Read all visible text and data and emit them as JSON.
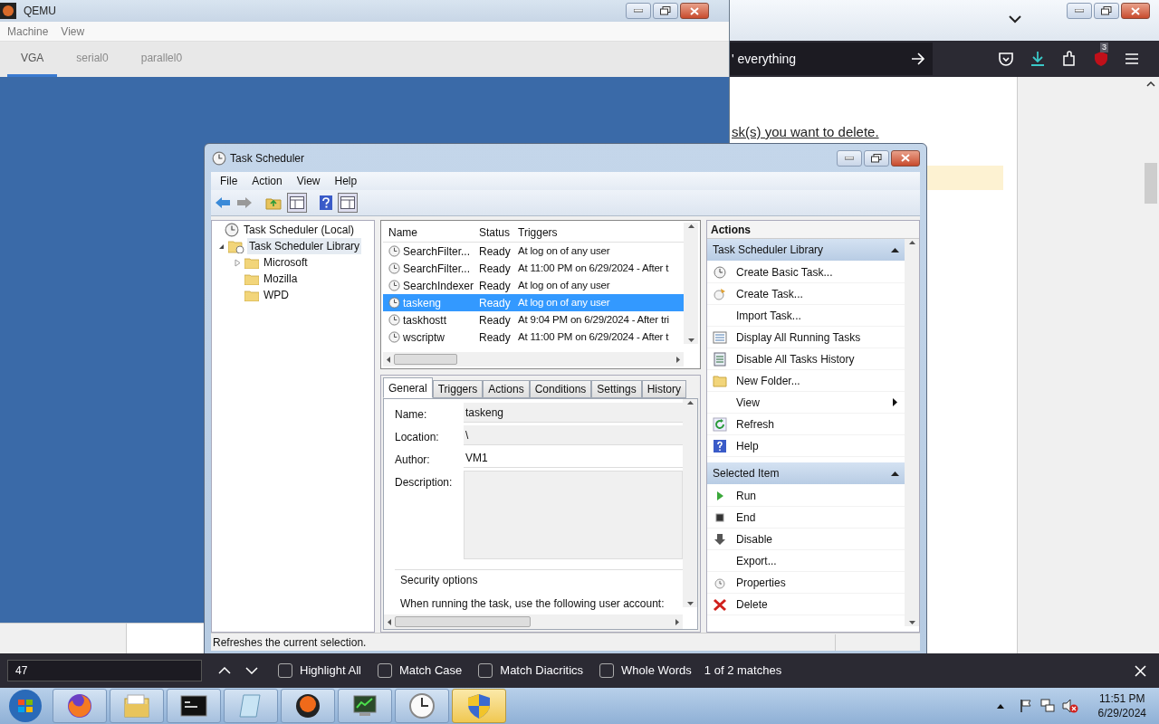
{
  "qemu": {
    "title": "QEMU",
    "menu": [
      "Machine",
      "View"
    ],
    "tabs": [
      {
        "label": "VGA",
        "selected": true
      },
      {
        "label": "serial0",
        "selected": false
      },
      {
        "label": "parallel0",
        "selected": false
      }
    ]
  },
  "browser": {
    "address_text": "' everything",
    "badge": "3",
    "page_text": "sk(s) you want to delete."
  },
  "task_scheduler": {
    "title": "Task Scheduler",
    "menu": [
      "File",
      "Action",
      "View",
      "Help"
    ],
    "tree": [
      {
        "label": "Task Scheduler (Local)",
        "kind": "root",
        "selected": false,
        "children": [
          {
            "label": "Task Scheduler Library",
            "kind": "library",
            "expanded": true,
            "selected": true,
            "children": [
              {
                "label": "Microsoft",
                "kind": "folder",
                "expanded": false,
                "selected": false
              },
              {
                "label": "Mozilla",
                "kind": "folder",
                "selected": false
              },
              {
                "label": "WPD",
                "kind": "folder",
                "selected": false
              }
            ]
          }
        ]
      }
    ],
    "task_list": {
      "columns": [
        "Name",
        "Status",
        "Triggers"
      ],
      "rows": [
        {
          "name": "SearchFilter...",
          "status": "Ready",
          "triggers": "At log on of any user",
          "selected": false
        },
        {
          "name": "SearchFilter...",
          "status": "Ready",
          "triggers": "At 11:00 PM on 6/29/2024 - After t",
          "selected": false
        },
        {
          "name": "SearchIndexer",
          "status": "Ready",
          "triggers": "At log on of any user",
          "selected": false
        },
        {
          "name": "taskeng",
          "status": "Ready",
          "triggers": "At log on of any user",
          "selected": true
        },
        {
          "name": "taskhostt",
          "status": "Ready",
          "triggers": "At 9:04 PM on 6/29/2024 - After tri",
          "selected": false
        },
        {
          "name": "wscriptw",
          "status": "Ready",
          "triggers": "At 11:00 PM on 6/29/2024 - After t",
          "selected": false
        }
      ]
    },
    "detail_tabs": [
      {
        "label": "General",
        "selected": true
      },
      {
        "label": "Triggers",
        "selected": false
      },
      {
        "label": "Actions",
        "selected": false
      },
      {
        "label": "Conditions",
        "selected": false
      },
      {
        "label": "Settings",
        "selected": false
      },
      {
        "label": "History",
        "selected": false
      }
    ],
    "general": {
      "fields": [
        {
          "label": "Name:",
          "value": "taskeng",
          "kind": "gray"
        },
        {
          "label": "Location:",
          "value": "\\",
          "kind": "gray"
        },
        {
          "label": "Author:",
          "value": "VM1",
          "kind": "white"
        },
        {
          "label": "Description:",
          "kind": "area"
        }
      ],
      "security_title": "Security options",
      "security_text": "When running the task, use the following user account:"
    },
    "actions": {
      "title": "Actions",
      "sections": [
        {
          "title": "Task Scheduler Library",
          "expanded": true,
          "items": [
            {
              "label": "Create Basic Task...",
              "kind": "clock"
            },
            {
              "label": "Create Task...",
              "kind": "task"
            },
            {
              "label": "Import Task...",
              "kind": "plain"
            },
            {
              "label": "Display All Running Tasks",
              "kind": "list"
            },
            {
              "label": "Disable All Tasks History",
              "kind": "history"
            },
            {
              "label": "New Folder...",
              "kind": "folder"
            },
            {
              "label": "View",
              "kind": "submenu"
            },
            {
              "label": "Refresh",
              "kind": "refresh"
            },
            {
              "label": "Help",
              "kind": "help"
            }
          ]
        },
        {
          "title": "Selected Item",
          "expanded": true,
          "items": [
            {
              "label": "Run",
              "kind": "run"
            },
            {
              "label": "End",
              "kind": "end"
            },
            {
              "label": "Disable",
              "kind": "disable"
            },
            {
              "label": "Export...",
              "kind": "plain"
            },
            {
              "label": "Properties",
              "kind": "properties"
            },
            {
              "label": "Delete",
              "kind": "delete"
            }
          ]
        }
      ]
    },
    "status_bar": "Refreshes the current selection."
  },
  "find_bar": {
    "value": "47",
    "options": [
      {
        "label": "Highlight All",
        "checked": false
      },
      {
        "label": "Match Case",
        "checked": false
      },
      {
        "label": "Match Diacritics",
        "checked": false
      },
      {
        "label": "Whole Words",
        "checked": false
      }
    ],
    "result": "1 of 2 matches"
  },
  "taskbar": {
    "apps": [
      {
        "kind": "firefox",
        "active": false
      },
      {
        "kind": "explorer",
        "active": false
      },
      {
        "kind": "cmd",
        "active": false
      },
      {
        "kind": "notepad",
        "active": false
      },
      {
        "kind": "qemu",
        "active": false
      },
      {
        "kind": "monitor",
        "active": false
      },
      {
        "kind": "clock",
        "active": false
      },
      {
        "kind": "shield",
        "active": true
      }
    ],
    "time": "11:51 PM",
    "date": "6/29/2024"
  }
}
